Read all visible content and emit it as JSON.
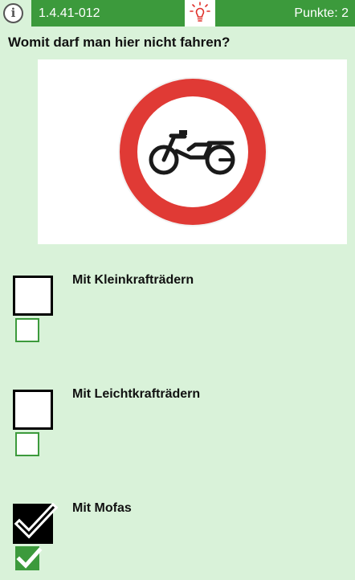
{
  "header": {
    "question_id": "1.4.41-012",
    "points_label": "Punkte: 2",
    "info_icon": "info-icon",
    "hint_icon": "lightbulb-icon"
  },
  "question": {
    "text": "Womit darf man hier nicht fahren?",
    "image_icon": "no-mopeds-sign-icon"
  },
  "answers": [
    {
      "label": "Mit Kleinkrafträdern",
      "checked": false,
      "correct": false
    },
    {
      "label": "Mit Leichtkrafträdern",
      "checked": false,
      "correct": false
    },
    {
      "label": "Mit Mofas",
      "checked": true,
      "correct": true
    }
  ],
  "colors": {
    "background": "#d9f2d9",
    "accent_green": "#3c9a3c",
    "sign_red": "#e03a35"
  }
}
